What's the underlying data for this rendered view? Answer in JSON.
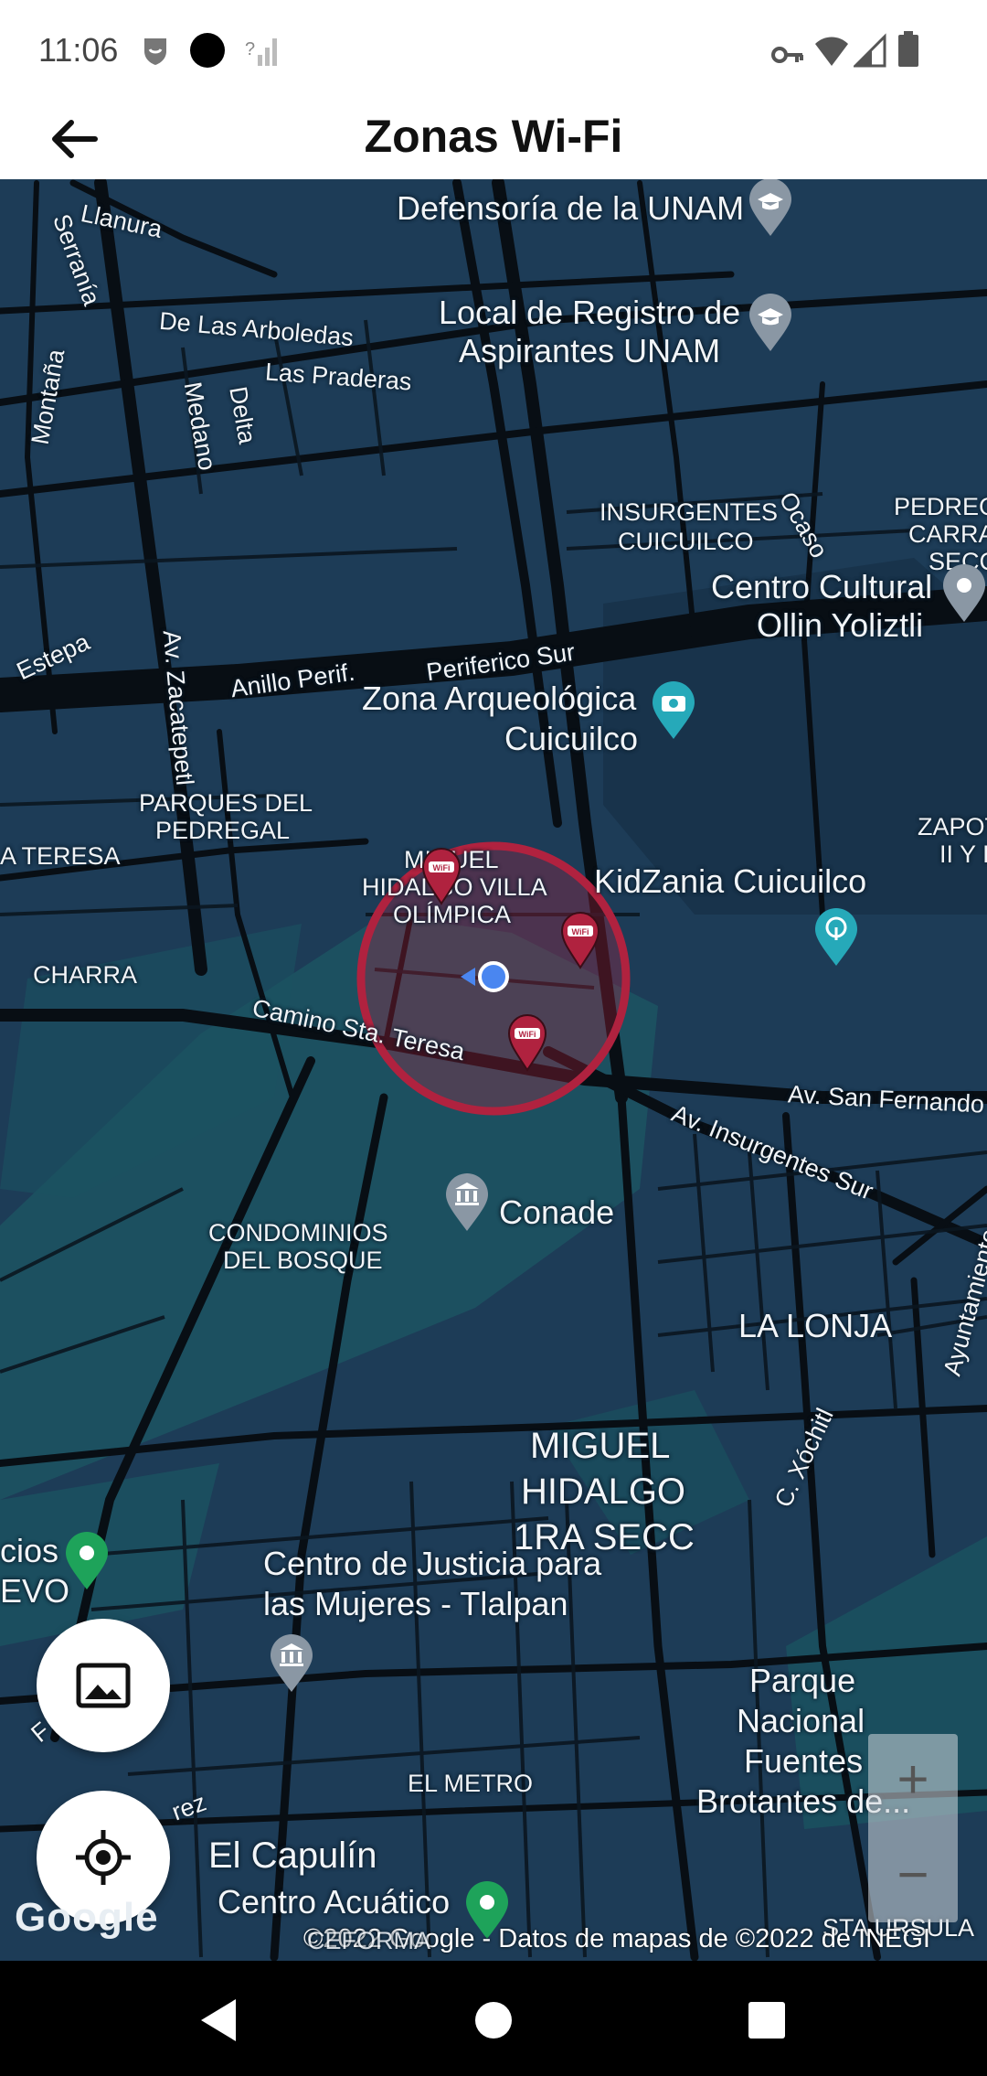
{
  "status_bar": {
    "time": "11:06",
    "signal_note": "?"
  },
  "app_bar": {
    "title": "Zonas Wi-Fi"
  },
  "map": {
    "labels": {
      "defensoria": "Defensoría de la UNAM",
      "registro_1": "Local de Registro de",
      "registro_2": "Aspirantes UNAM",
      "llanura": "Llanura",
      "serrania": "Serranía",
      "arboledas": "De Las Arboledas",
      "praderas": "Las Praderas",
      "medano": "Medano",
      "delta": "Delta",
      "montana": "Montaña",
      "insurgentes_cuicuilco_1": "INSURGENTES",
      "insurgentes_cuicuilco_2": "CUICUILCO",
      "ocaso": "Ocaso",
      "pedregal_1": "PEDREGA",
      "pedregal_2": "CARRAS",
      "pedregal_3": "SECC",
      "centro_cultural_1": "Centro Cultural",
      "centro_cultural_2": "Ollin Yoliztli",
      "estepa": "Estepa",
      "zacatepetl": "Av. Zacatepetl",
      "anillo": "Anillo Perif.",
      "periferico_sur": "Periferico Sur",
      "zona_arq_1": "Zona Arqueológica",
      "zona_arq_2": "Cuicuilco",
      "parques_1": "PARQUES DEL",
      "parques_2": "PEDREGAL",
      "teresa": "A TERESA",
      "miguel_villa_1": "MIGUEL",
      "miguel_villa_2": "HIDALGO VILLA",
      "miguel_villa_3": "OLÍMPICA",
      "kidzania": "KidZania Cuicuilco",
      "zapot_1": "ZAPOT",
      "zapot_2": "II Y I",
      "charra": "CHARRA",
      "camino": "Camino Sta. Teresa",
      "san_fernando": "Av. San Fernando",
      "insurgentes_sur": "Av. Insurgentes Sur",
      "conade": "Conade",
      "condominios_1": "CONDOMINIOS",
      "condominios_2": "DEL BOSQUE",
      "la_lonja": "LA LONJA",
      "ayuntamiento": "Ayuntamiento",
      "miguel_1ra_1": "MIGUEL",
      "miguel_1ra_2": "HIDALGO",
      "miguel_1ra_3": "1RA SECC",
      "xochitl": "C. Xóchitl",
      "cios": "cios",
      "evo": "EVO",
      "justicia_1": "Centro de Justicia para",
      "justicia_2": "las Mujeres - Tlalpan",
      "parque_1": "Parque",
      "parque_2": "Nacional",
      "parque_3": "Fuentes",
      "parque_4": "Brotantes de...",
      "el_metro": "EL METRO",
      "capulin": "El Capulín",
      "acuatico": "Centro Acuático",
      "sta_ursula": "STA URSULA",
      "rez": "rez",
      "f_letter": "F"
    },
    "google_logo": "Google",
    "copyright": "©2022 Google - Datos de mapas de ©2022 de INEGI",
    "copyright_overlap": "CEFORMA",
    "zoom_in": "+",
    "zoom_out": "−"
  },
  "colors": {
    "map_bg": "#1d3c57",
    "road": "#0a1118",
    "wifi_zone": "#b0223f",
    "user_dot": "#4a86f0"
  }
}
